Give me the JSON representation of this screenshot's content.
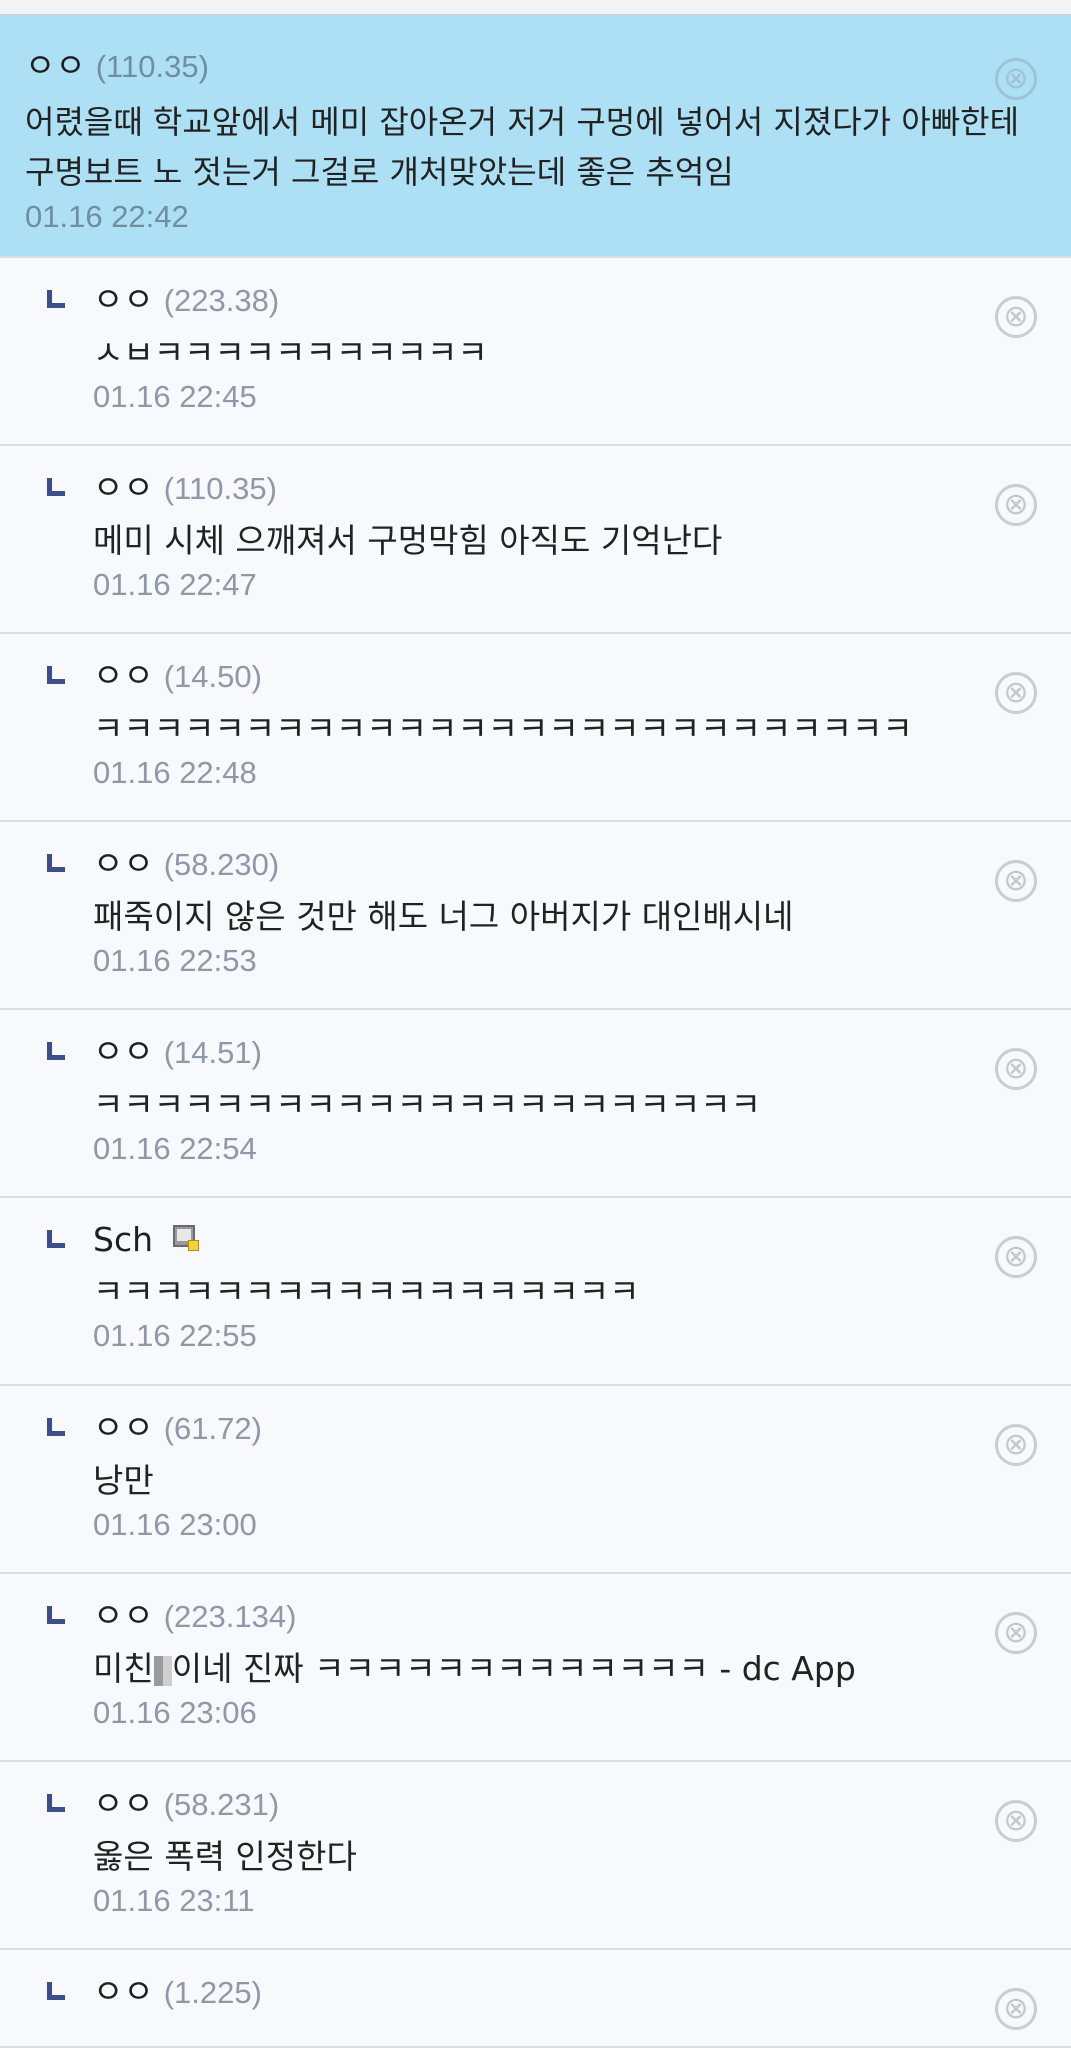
{
  "close_glyph": "⊗",
  "main_comment": {
    "nick": "ㅇㅇ",
    "ip": "(110.35)",
    "text": "어렸을때 학교앞에서 메미 잡아온거 저거 구멍에 넣어서 지졌다가 아빠한테 구명보트 노 젓는거 그걸로 개처맞았는데 좋은 추억임",
    "time": "01.16 22:42"
  },
  "replies": [
    {
      "nick": "ㅇㅇ",
      "ip": "(223.38)",
      "text": "ㅅㅂㅋㅋㅋㅋㅋㅋㅋㅋㅋㅋㅋ",
      "time": "01.16 22:45"
    },
    {
      "nick": "ㅇㅇ",
      "ip": "(110.35)",
      "text": "메미 시체 으깨져서 구멍막힘 아직도 기억난다",
      "time": "01.16 22:47"
    },
    {
      "nick": "ㅇㅇ",
      "ip": "(14.50)",
      "text": "ㅋㅋㅋㅋㅋㅋㅋㅋㅋㅋㅋㅋㅋㅋㅋㅋㅋㅋㅋㅋㅋㅋㅋㅋㅋㅋㅋ",
      "time": "01.16 22:48"
    },
    {
      "nick": "ㅇㅇ",
      "ip": "(58.230)",
      "text": "패죽이지 않은 것만 해도 너그 아버지가 대인배시네",
      "time": "01.16 22:53"
    },
    {
      "nick": "ㅇㅇ",
      "ip": "(14.51)",
      "text": "ㅋㅋㅋㅋㅋㅋㅋㅋㅋㅋㅋㅋㅋㅋㅋㅋㅋㅋㅋㅋㅋㅋ",
      "time": "01.16 22:54"
    },
    {
      "nick": "Sch",
      "text": "ㅋㅋㅋㅋㅋㅋㅋㅋㅋㅋㅋㅋㅋㅋㅋㅋㅋㅋ",
      "time": "01.16 22:55"
    },
    {
      "nick": "ㅇㅇ",
      "ip": "(61.72)",
      "text": "낭만",
      "time": "01.16 23:00"
    },
    {
      "nick": "ㅇㅇ",
      "ip": "(223.134)",
      "text_before": "미친",
      "text_after": "이네 진짜 ㅋㅋㅋㅋㅋㅋㅋㅋㅋㅋㅋㅋㅋ - dc App",
      "time": "01.16 23:06"
    },
    {
      "nick": "ㅇㅇ",
      "ip": "(58.231)",
      "text": "옳은 폭력 인정한다",
      "time": "01.16 23:11"
    },
    {
      "nick": "ㅇㅇ",
      "ip": "(1.225)"
    }
  ]
}
